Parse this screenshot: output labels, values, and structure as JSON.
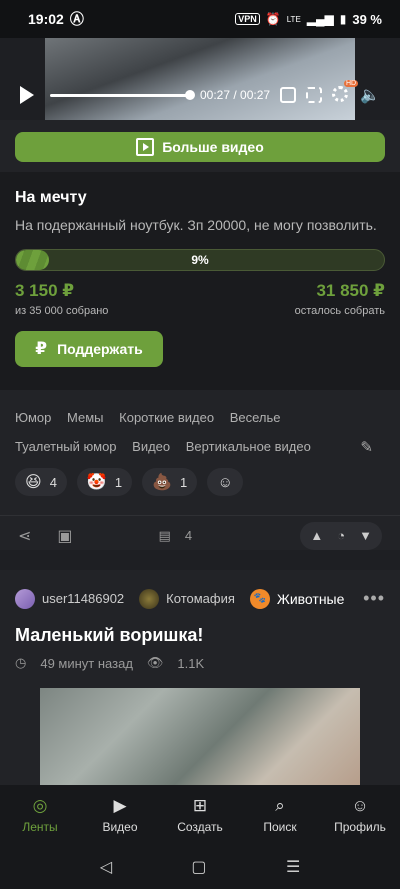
{
  "status": {
    "time": "19:02",
    "vpn": "VPN",
    "battery": "39 %",
    "signal": "LTE"
  },
  "video": {
    "time": "00:27 / 00:27",
    "quality_badge": "HD",
    "progress": 1.0
  },
  "more_video": {
    "label": "Больше видео"
  },
  "fund": {
    "title": "На мечту",
    "description": "На подержанный ноутбук. Зп 20000, не могу позволить.",
    "percent_label": "9%",
    "percent": 9,
    "collected": "3 150 ₽",
    "collected_sub": "из 35 000 собрано",
    "remaining": "31 850 ₽",
    "remaining_sub": "осталось собрать",
    "support_label": "Поддержать"
  },
  "tags": [
    "Юмор",
    "Мемы",
    "Короткие видео",
    "Веселье",
    "Туалетный юмор",
    "Видео",
    "Вертикальное видео"
  ],
  "reactions": [
    {
      "emoji": "😆",
      "count": "4"
    },
    {
      "emoji": "🤡",
      "count": "1"
    },
    {
      "emoji": "💩",
      "count": "1"
    }
  ],
  "actions": {
    "comments_count": "4"
  },
  "post": {
    "author": "user11486902",
    "community": "Котомафия",
    "category": "Животные",
    "title": "Маленький воришка!",
    "time_ago": "49 минут назад",
    "views": "1.1K"
  },
  "tabbar": [
    {
      "label": "Ленты",
      "icon": "feed-icon",
      "active": true
    },
    {
      "label": "Видео",
      "icon": "video-icon",
      "active": false
    },
    {
      "label": "Создать",
      "icon": "plus-icon",
      "active": false
    },
    {
      "label": "Поиск",
      "icon": "search-icon",
      "active": false
    },
    {
      "label": "Профиль",
      "icon": "profile-icon",
      "active": false
    }
  ],
  "colors": {
    "accent": "#6ea03c",
    "background": "#1e1f23"
  }
}
